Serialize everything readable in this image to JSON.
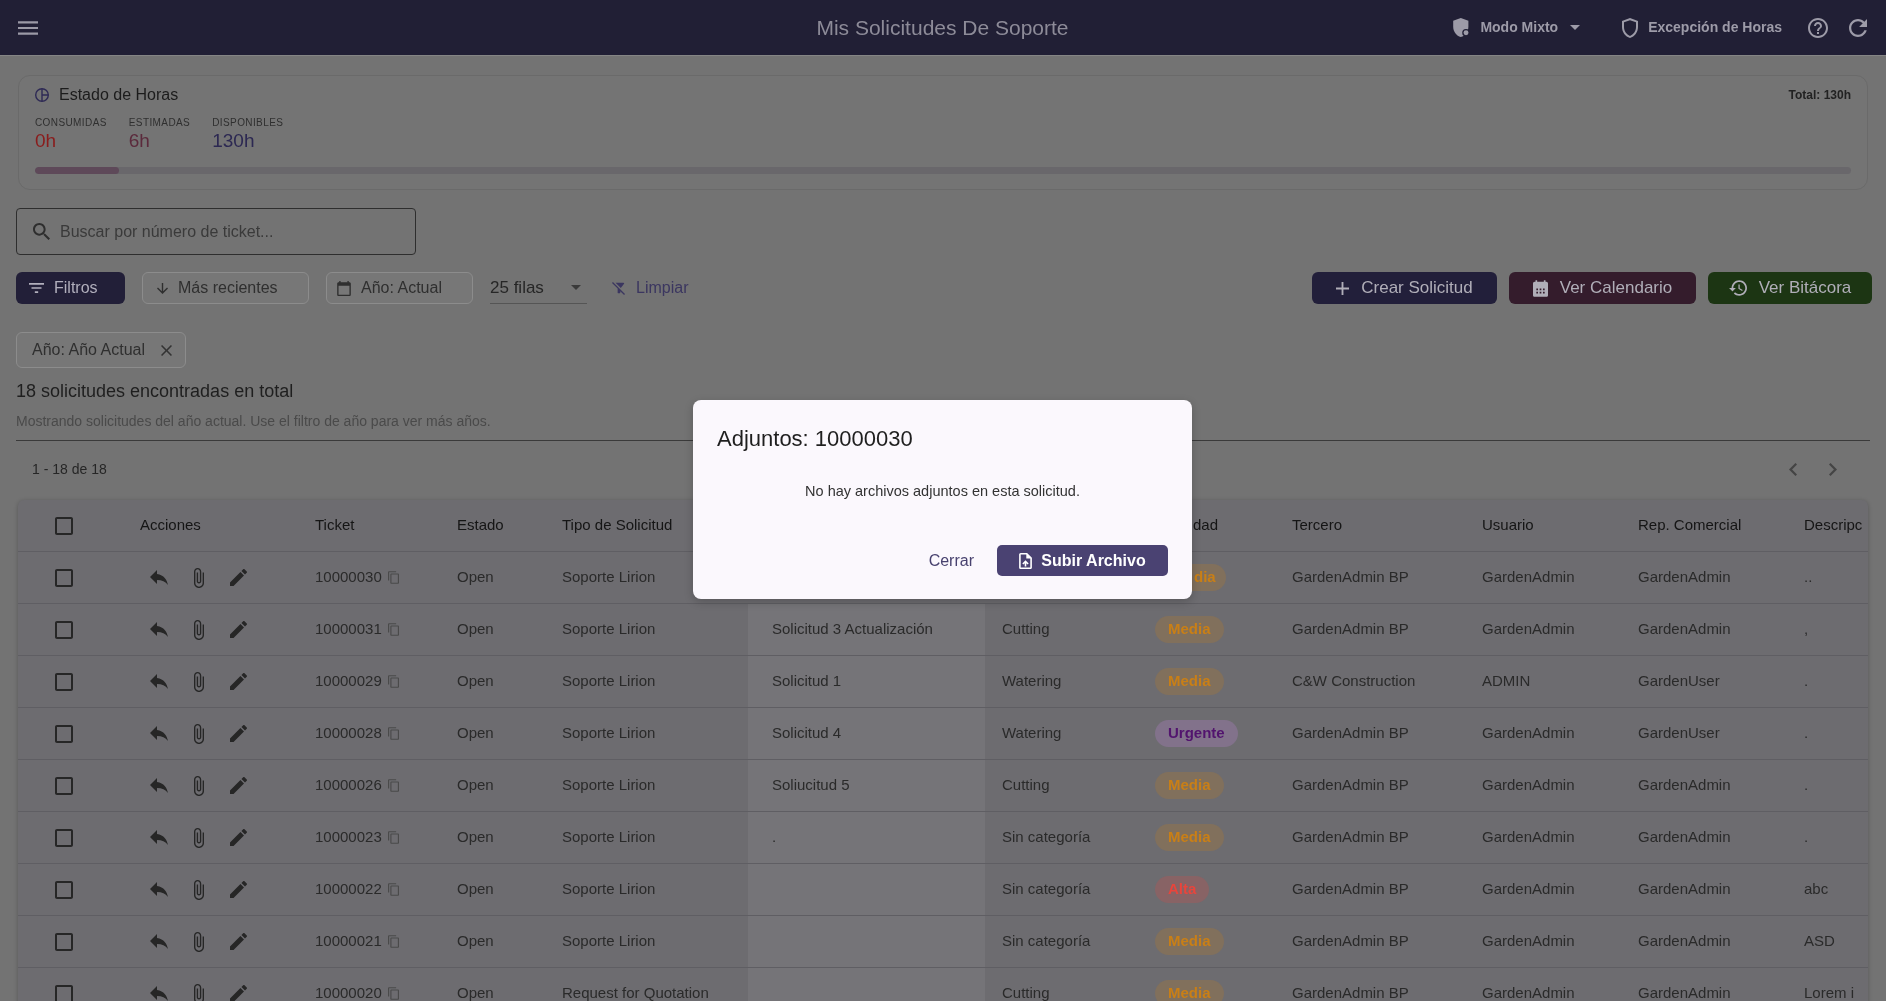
{
  "app_bar": {
    "title": "Mis Solicitudes De Soporte",
    "mode": "Modo Mixto",
    "exception": "Excepción de Horas"
  },
  "hours": {
    "title": "Estado de Horas",
    "total": "Total: 130h",
    "stats": [
      {
        "label": "CONSUMIDAS",
        "value": "0h",
        "color": "#8a1c1c"
      },
      {
        "label": "ESTIMADAS",
        "value": "6h",
        "color": "#5b2a3c"
      },
      {
        "label": "DISPONIBLES",
        "value": "130h",
        "color": "#2c2852"
      }
    ],
    "level": 0.046
  },
  "search": {
    "placeholder": "Buscar por número de ticket..."
  },
  "toolbar": {
    "filters": [
      {
        "kind": "filter",
        "label": "Filtros"
      },
      {
        "kind": "sort",
        "label": "Más recientes"
      },
      {
        "kind": "year",
        "label": "Año: Actual"
      }
    ],
    "rows_select": "25 filas",
    "clear": "Limpiar",
    "actions": [
      {
        "kind": "create",
        "label": "Crear Solicitud",
        "color": "#221f3a"
      },
      {
        "kind": "calendar",
        "label": "Ver Calendario",
        "color": "#341c2c"
      },
      {
        "kind": "history",
        "label": "Ver Bitácora",
        "color": "#1c3513"
      }
    ]
  },
  "active_filters": [
    {
      "label": "Año: Año Actual"
    }
  ],
  "summary": "18 solicitudes encontradas en total",
  "note": "Mostrando solicitudes del año actual. Use el filtro de año para ver más años.",
  "pagination": {
    "range": "1 - 18 de 18"
  },
  "table": {
    "select_all": {
      "checked": false
    },
    "columns": {
      "actions": "Acciones",
      "ticket": "Ticket",
      "status": "Estado",
      "type": "Tipo de Solicitud",
      "column_8": "dad",
      "third_party": "Tercero",
      "user": "Usuario",
      "sales_rep": "Rep. Comercial",
      "column_12": "Descripc"
    },
    "rows": [
      {
        "checked": false,
        "ticket": "10000030",
        "status": "Open",
        "type": "Soporte Lirion",
        "column_8": {
          "label": "dia",
          "color": "#c97f16"
        },
        "third_party": "GardenAdmin BP",
        "user": "GardenAdmin",
        "sales_rep": "GardenAdmin",
        "column_12": ".."
      },
      {
        "checked": false,
        "ticket": "10000031",
        "status": "Open",
        "type": "Soporte Lirion",
        "column_6": "Solicitud 3 Actualización",
        "column_7": "Cutting",
        "column_8": {
          "label": "Media",
          "color": "#c97f16"
        },
        "third_party": "GardenAdmin BP",
        "user": "GardenAdmin",
        "sales_rep": "GardenAdmin",
        "column_12": ","
      },
      {
        "checked": false,
        "ticket": "10000029",
        "status": "Open",
        "type": "Soporte Lirion",
        "column_6": "Solicitud 1",
        "column_7": "Watering",
        "column_8": {
          "label": "Media",
          "color": "#c97f16"
        },
        "third_party": "C&W Construction",
        "user": "ADMIN",
        "sales_rep": "GardenUser",
        "column_12": "."
      },
      {
        "checked": false,
        "ticket": "10000028",
        "status": "Open",
        "type": "Soporte Lirion",
        "column_6": "Solicitud 4",
        "column_7": "Watering",
        "column_8": {
          "label": "Urgente",
          "color": "#52146e"
        },
        "third_party": "GardenAdmin BP",
        "user": "GardenAdmin",
        "sales_rep": "GardenUser",
        "column_12": "."
      },
      {
        "checked": false,
        "ticket": "10000026",
        "status": "Open",
        "type": "Soporte Lirion",
        "column_6": "Soliucitud 5",
        "column_7": "Cutting",
        "column_8": {
          "label": "Media",
          "color": "#c97f16"
        },
        "third_party": "GardenAdmin BP",
        "user": "GardenAdmin",
        "sales_rep": "GardenAdmin",
        "column_12": "."
      },
      {
        "checked": false,
        "ticket": "10000023",
        "status": "Open",
        "type": "Soporte Lirion",
        "column_6": ".",
        "column_7": "Sin categoría",
        "column_8": {
          "label": "Media",
          "color": "#c97f16"
        },
        "third_party": "GardenAdmin BP",
        "user": "GardenAdmin",
        "sales_rep": "GardenAdmin",
        "column_12": "."
      },
      {
        "checked": false,
        "ticket": "10000022",
        "status": "Open",
        "type": "Soporte Lirion",
        "column_7": "Sin categoría",
        "column_8": {
          "label": "Alta",
          "color": "#e8453c"
        },
        "third_party": "GardenAdmin BP",
        "user": "GardenAdmin",
        "sales_rep": "GardenAdmin",
        "column_12": "abc"
      },
      {
        "checked": false,
        "ticket": "10000021",
        "status": "Open",
        "type": "Soporte Lirion",
        "column_7": "Sin categoría",
        "column_8": {
          "label": "Media",
          "color": "#c97f16"
        },
        "third_party": "GardenAdmin BP",
        "user": "GardenAdmin",
        "sales_rep": "GardenAdmin",
        "column_12": "ASD"
      },
      {
        "checked": false,
        "ticket": "10000020",
        "status": "Open",
        "type": "Request for Quotation",
        "column_7": "Cutting",
        "column_8": {
          "label": "Media",
          "color": "#c97f16"
        },
        "third_party": "GardenAdmin BP",
        "user": "GardenAdmin",
        "sales_rep": "GardenAdmin",
        "column_12": "Lorem i"
      }
    ]
  },
  "dialog": {
    "title": "Adjuntos: 10000030",
    "message": "No hay archivos adjuntos en esta solicitud.",
    "buttons": [
      {
        "kind": "text",
        "label": "Cerrar"
      },
      {
        "kind": "upload",
        "label": "Subir Archivo"
      }
    ]
  }
}
